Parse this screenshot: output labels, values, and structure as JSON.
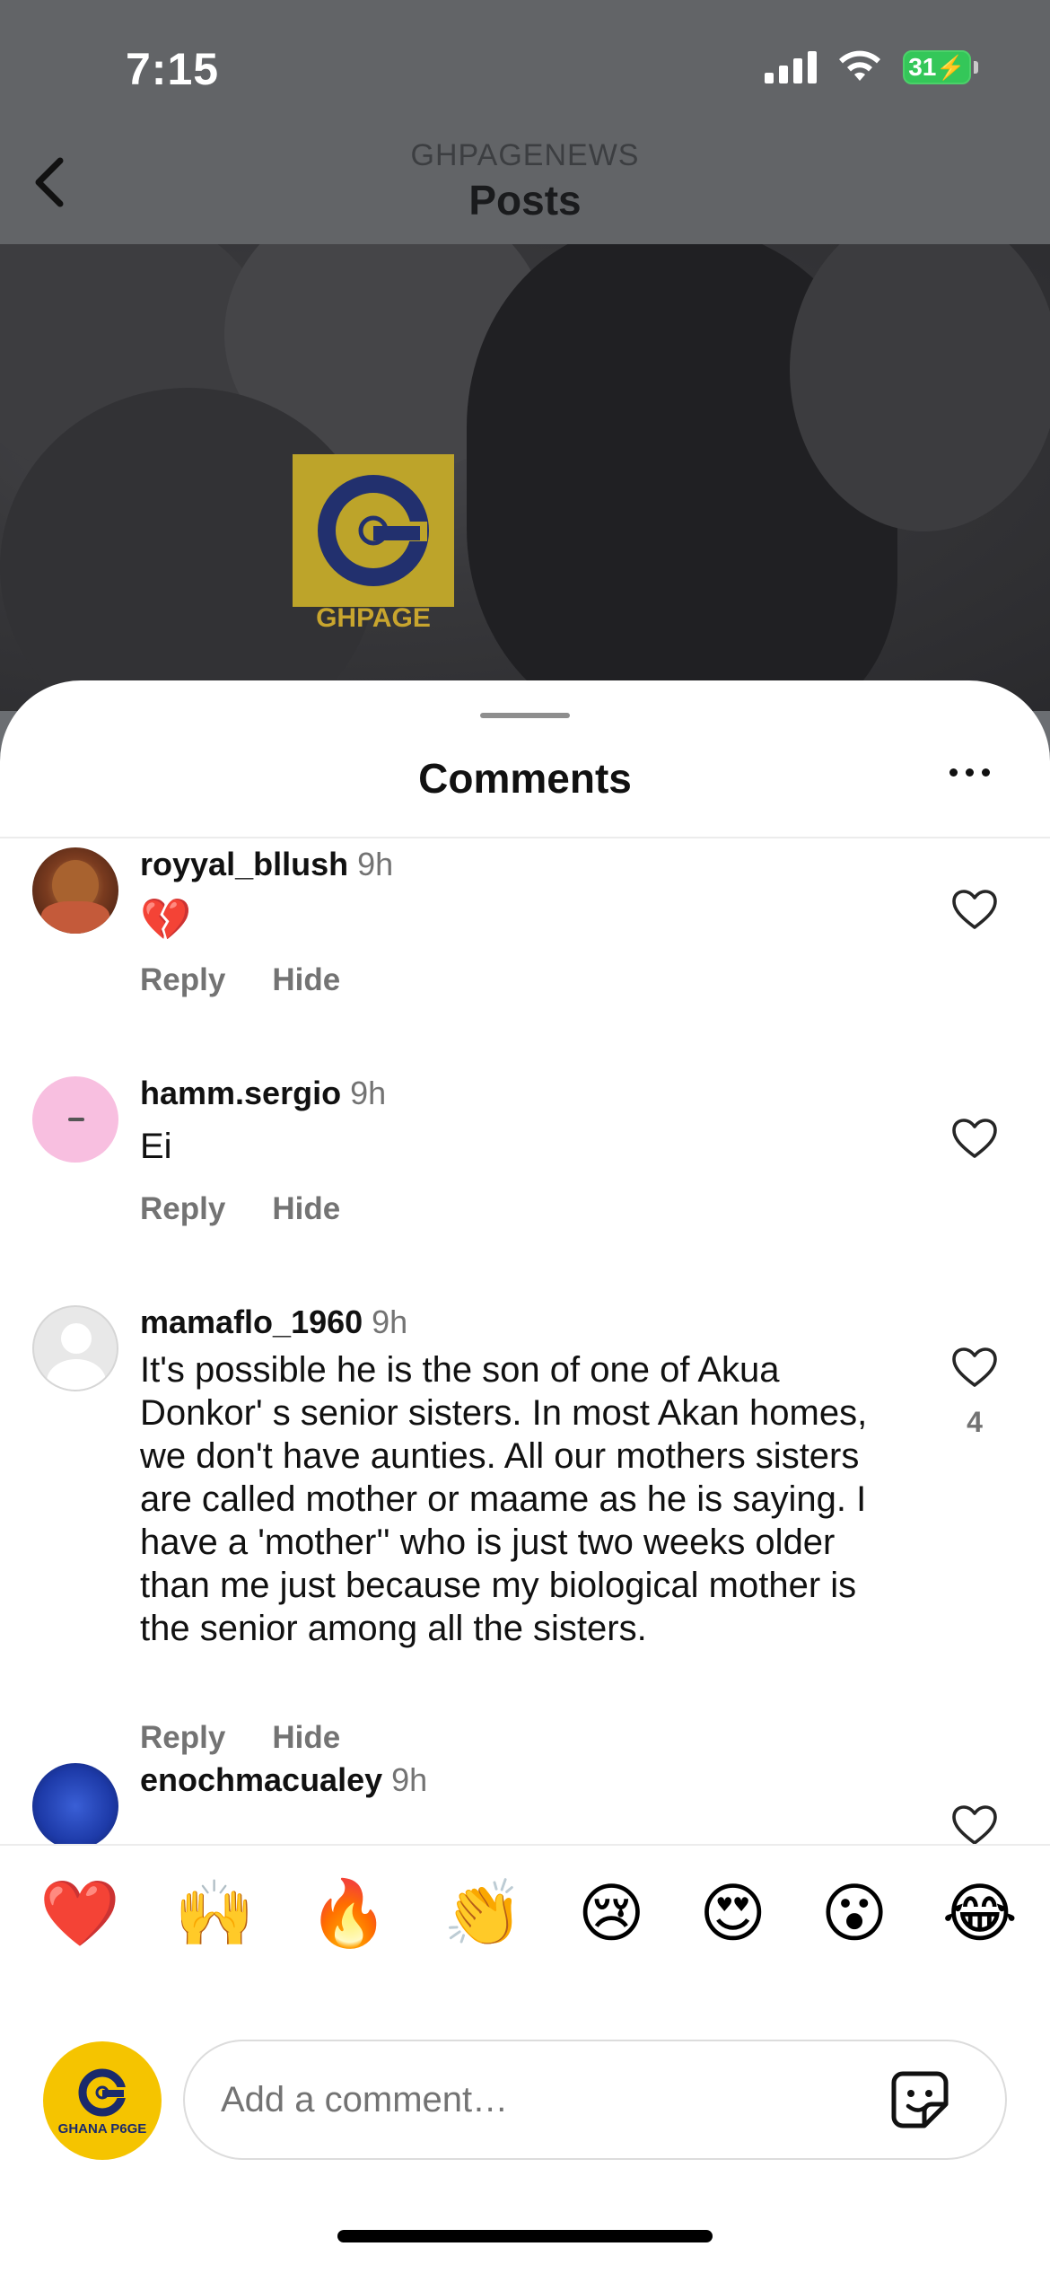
{
  "status_bar": {
    "time": "7:15",
    "battery": "31",
    "icons": [
      "signal-icon",
      "wifi-icon",
      "battery-charging-icon"
    ]
  },
  "header": {
    "account": "GHPAGENEWS",
    "title": "Posts",
    "back_icon": "chevron-left-icon"
  },
  "post": {
    "watermark": "GHPAGE",
    "watermark_color": "#bda42a"
  },
  "comments_sheet": {
    "title": "Comments",
    "more_icon": "ellipsis-icon",
    "items": [
      {
        "username": "royyal_bllush",
        "time": "9h",
        "text": "💔",
        "reply_label": "Reply",
        "hide_label": "Hide",
        "likes": ""
      },
      {
        "username": "hamm.sergio",
        "time": "9h",
        "text": "Ei",
        "reply_label": "Reply",
        "hide_label": "Hide",
        "likes": ""
      },
      {
        "username": "mamaflo_1960",
        "time": "9h",
        "text": "It's possible he is the son of one of Akua Donkor' s senior sisters. In most Akan homes, we don't have aunties. All our mothers sisters are called mother or maame as he is saying. I have a 'mother'' who is just two weeks older than me just because my biological mother is the senior among all the sisters.",
        "reply_label": "Reply",
        "hide_label": "Hide",
        "likes": "4"
      },
      {
        "username": "enochmacualey",
        "time": "9h",
        "text": "",
        "reply_label": "",
        "hide_label": "",
        "likes": ""
      }
    ]
  },
  "composer": {
    "emojis": [
      "❤️",
      "🙌",
      "🔥",
      "👏",
      "😢",
      "😍",
      "😮",
      "😂"
    ],
    "avatar_label": "GHANA P6GE",
    "placeholder": "Add a comment…",
    "sticker_icon": "sticker-icon",
    "accent_color": "#f5c400"
  }
}
